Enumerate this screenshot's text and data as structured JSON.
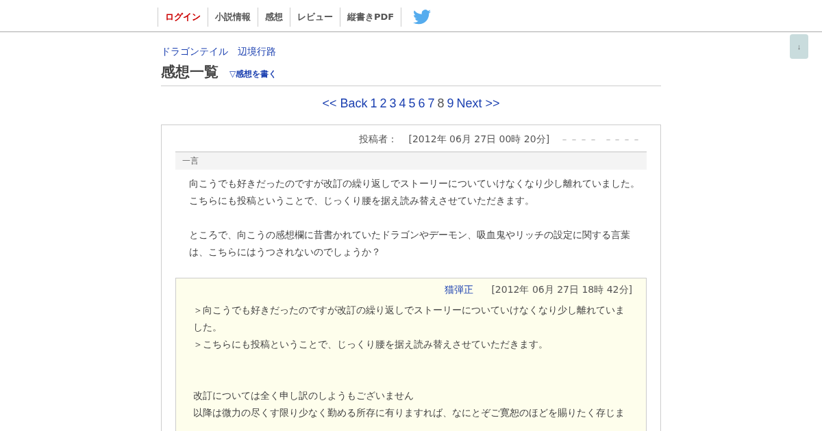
{
  "nav": [
    {
      "label": "ログイン",
      "selected": true
    },
    {
      "label": "小説情報",
      "selected": false
    },
    {
      "label": "感想",
      "selected": false
    },
    {
      "label": "レビュー",
      "selected": false
    },
    {
      "label": "縦書きPDF",
      "selected": false
    }
  ],
  "breadcrumb": [
    "ドラゴンテイル",
    "辺境行路"
  ],
  "page_title": "感想一覧",
  "write_link": "▽感想を書く",
  "scroll_button": "↓",
  "pagination": [
    {
      "label": "<< Back",
      "selected": false
    },
    {
      "label": "1",
      "selected": false
    },
    {
      "label": "2",
      "selected": false
    },
    {
      "label": "3",
      "selected": false
    },
    {
      "label": "4",
      "selected": false
    },
    {
      "label": "5",
      "selected": false
    },
    {
      "label": "6",
      "selected": false
    },
    {
      "label": "7",
      "selected": false
    },
    {
      "label": "8",
      "selected": true
    },
    {
      "label": "9",
      "selected": false
    },
    {
      "label": "Next >>",
      "selected": false
    }
  ],
  "comment": {
    "author_label": "投稿者：",
    "date": "[2012年 06月 27日 00時 20分]",
    "rating": "－ － － －　－ － － －",
    "section": "一言",
    "paragraphs": [
      [
        "向こうでも好きだったのですが改訂の繰り返しでストーリーについていけなくなり少し離れていました。",
        "こちらにも投稿ということで、じっくり腰を据え読み替えさせていただきます。"
      ],
      [
        "ところで、向こうの感想欄に昔書かれていたドラゴンやデーモン、吸血鬼やリッチの設定に関する言葉は、こちらにはうつされないのでしょうか？"
      ]
    ],
    "reply": {
      "author": "猫弾正",
      "date": "[2012年 06月 27日 18時 42分]",
      "paragraphs": [
        [
          "＞向こうでも好きだったのですが改訂の繰り返しでストーリーについていけなくなり少し離れていました。",
          "＞こちらにも投稿ということで、じっくり腰を据え読み替えさせていただきます。"
        ],
        [
          "改訂については全く申し訳のしようもございません",
          "以降は微力の尽くす限り少なく勤める所存に有りますれば、なにとぞご寛恕のほどを賜りたく存じま"
        ]
      ]
    }
  }
}
